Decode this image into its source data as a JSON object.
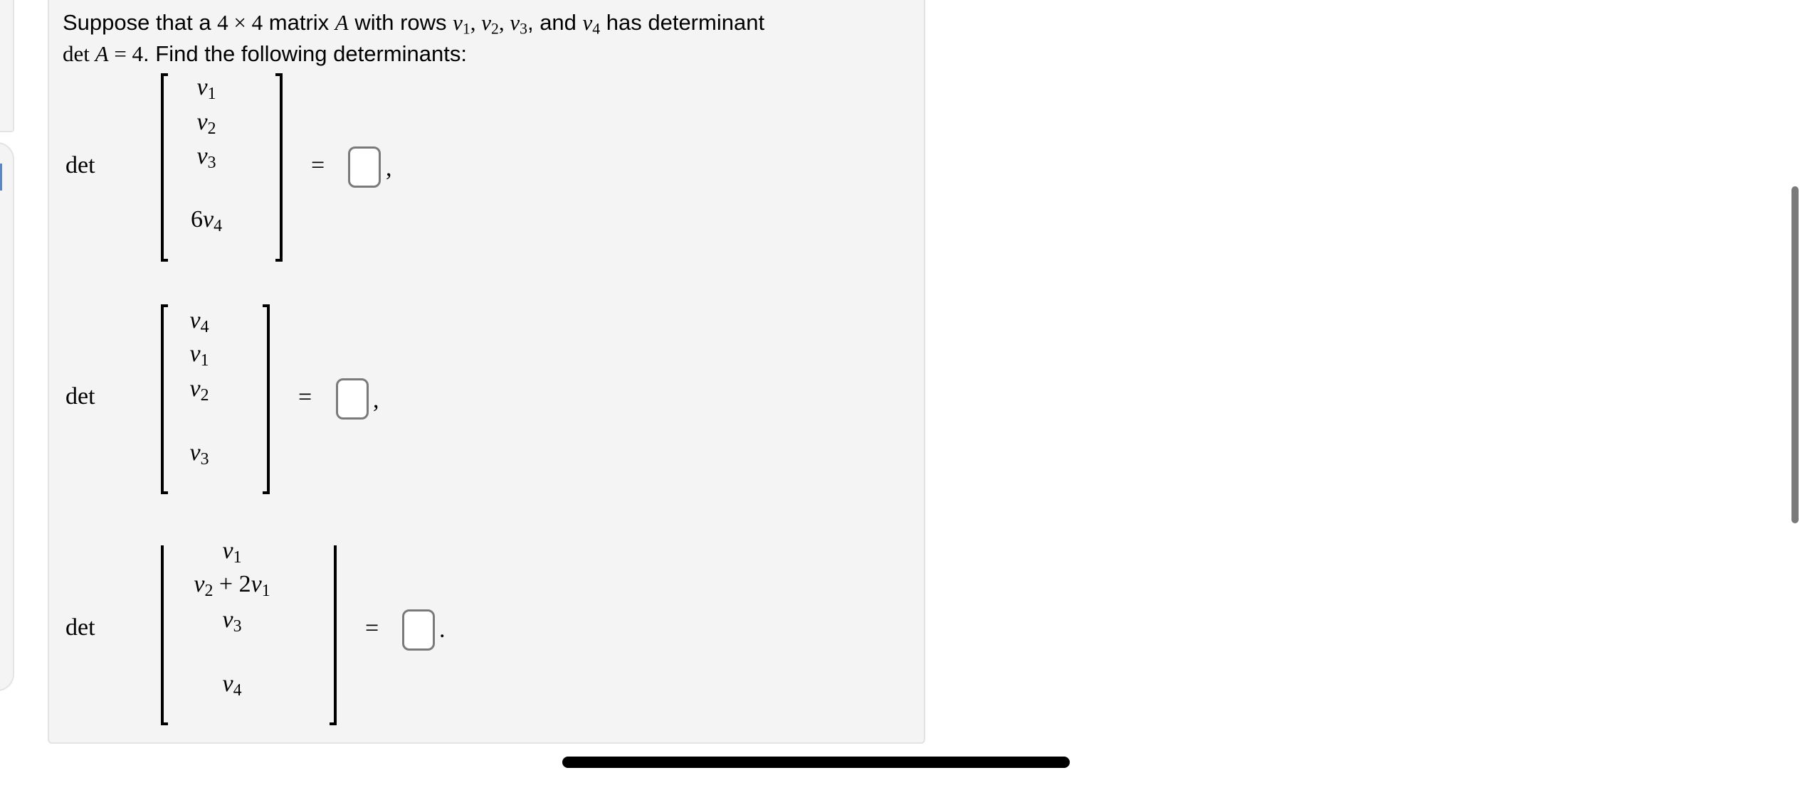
{
  "problem": {
    "intro_parts": {
      "p1": "Suppose that a ",
      "dim": "4 × 4",
      "p2": " matrix ",
      "matrix_name": "A",
      "p3": " with rows ",
      "v1": "v",
      "v1_sub": "1",
      "sep1": ", ",
      "v2": "v",
      "v2_sub": "2",
      "sep2": ", ",
      "v3": "v",
      "v3_sub": "3",
      "p4": ", and ",
      "v4": "v",
      "v4_sub": "4",
      "p5": " has determinant",
      "det_expr_prefix": "det ",
      "det_A": "A",
      "det_eq": " = 4",
      "p6": ". Find the following determinants:"
    },
    "det_label": "det",
    "equals": "=",
    "determinants": [
      {
        "rows": [
          {
            "coef": "",
            "var": "v",
            "sub": "1"
          },
          {
            "coef": "",
            "var": "v",
            "sub": "2"
          },
          {
            "coef": "",
            "var": "v",
            "sub": "3"
          },
          {
            "coef": "6",
            "var": "v",
            "sub": "4"
          }
        ],
        "answer_value": "",
        "trailing_punct": ","
      },
      {
        "rows": [
          {
            "coef": "",
            "var": "v",
            "sub": "4"
          },
          {
            "coef": "",
            "var": "v",
            "sub": "1"
          },
          {
            "coef": "",
            "var": "v",
            "sub": "2"
          },
          {
            "coef": "",
            "var": "v",
            "sub": "3"
          }
        ],
        "answer_value": "",
        "trailing_punct": ","
      },
      {
        "rows": [
          {
            "coef": "",
            "var": "v",
            "sub": "1"
          },
          {
            "coef": "",
            "var": "v",
            "sub": "2",
            "extra": " + 2",
            "var2": "v",
            "sub2": "1"
          },
          {
            "coef": "",
            "var": "v",
            "sub": "3"
          },
          {
            "coef": "",
            "var": "v",
            "sub": "4"
          }
        ],
        "answer_value": "",
        "trailing_punct": "."
      }
    ]
  },
  "colors": {
    "panel_bg": "#f4f4f4",
    "accent": "#5b86c6",
    "input_border": "#7a7a7a"
  }
}
